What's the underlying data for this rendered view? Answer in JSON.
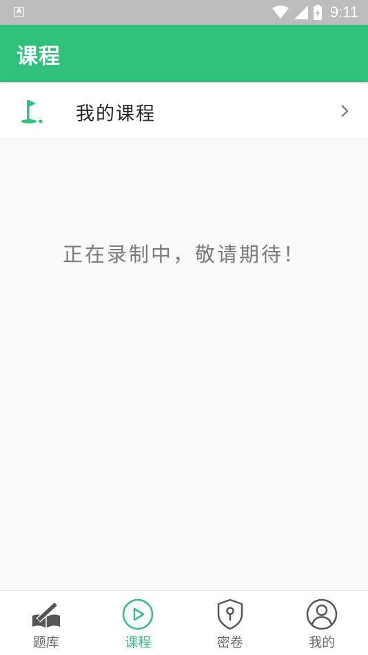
{
  "status_bar": {
    "notification_icon": "A",
    "time": "9:11",
    "icons": [
      "wifi-icon",
      "signal-icon",
      "battery-icon"
    ]
  },
  "app_bar": {
    "title": "课程"
  },
  "course_row": {
    "icon": "golf-flag-icon",
    "label": "我的课程",
    "chevron": "chevron-right-icon"
  },
  "empty_state": {
    "message": "正在录制中，敬请期待！"
  },
  "bottom_nav": {
    "items": [
      {
        "label": "题库",
        "icon": "book-pen-icon",
        "active": false
      },
      {
        "label": "课程",
        "icon": "play-circle-icon",
        "active": true
      },
      {
        "label": "密卷",
        "icon": "lock-shield-icon",
        "active": false
      },
      {
        "label": "我的",
        "icon": "user-circle-icon",
        "active": false
      }
    ]
  },
  "colors": {
    "accent": "#2ec27a",
    "status_bar": "#bdbdbd",
    "inactive": "#666666",
    "background": "#fafafa"
  }
}
